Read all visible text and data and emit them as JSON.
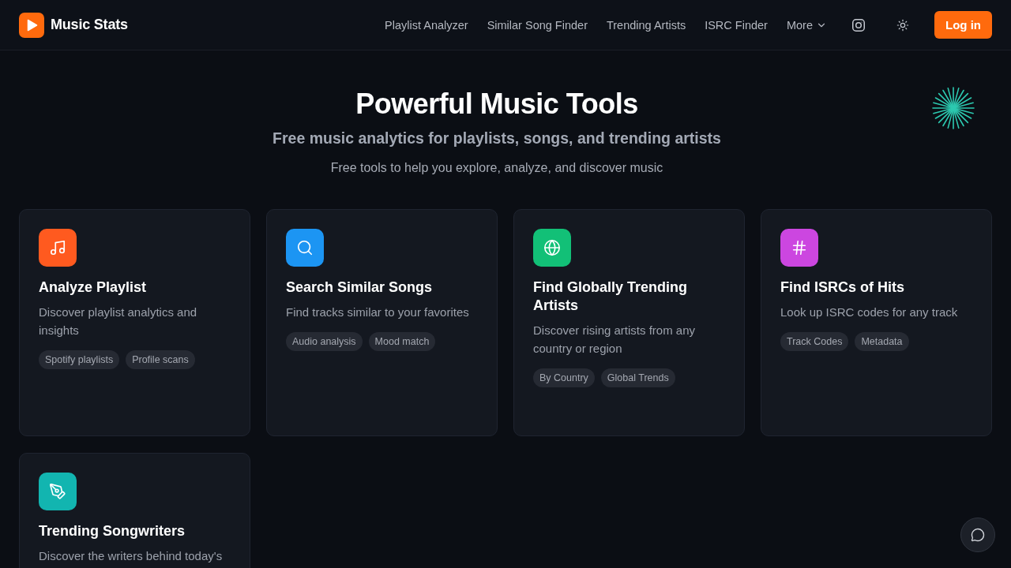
{
  "header": {
    "brand": "Music Stats",
    "nav": [
      "Playlist Analyzer",
      "Similar Song Finder",
      "Trending Artists",
      "ISRC Finder"
    ],
    "more_menu": {
      "label": "More"
    },
    "login": "Log in"
  },
  "hero": {
    "title": "Powerful Music Tools",
    "subtitle": "Free music analytics for playlists, songs, and trending artists",
    "tagline": "Free tools to help you explore, analyze, and discover music"
  },
  "tools": [
    {
      "title": "Analyze Playlist",
      "description": "Discover playlist analytics and insights",
      "tags": [
        "Spotify playlists",
        "Profile scans"
      ],
      "color": "#ff5a1f"
    },
    {
      "title": "Search Similar Songs",
      "description": "Find tracks similar to your favorites",
      "tags": [
        "Audio analysis",
        "Mood match"
      ],
      "color": "#1c95f3"
    },
    {
      "title": "Find Globally Trending Artists",
      "description": "Discover rising artists from any country or region",
      "tags": [
        "By Country",
        "Global Trends"
      ],
      "color": "#12c077"
    },
    {
      "title": "Find ISRCs of Hits",
      "description": "Look up ISRC codes for any track",
      "tags": [
        "Track Codes",
        "Metadata"
      ],
      "color": "#cc46e0"
    },
    {
      "title": "Trending Songwriters",
      "description": "Discover the writers behind today's",
      "color": "#12b5b0"
    }
  ]
}
